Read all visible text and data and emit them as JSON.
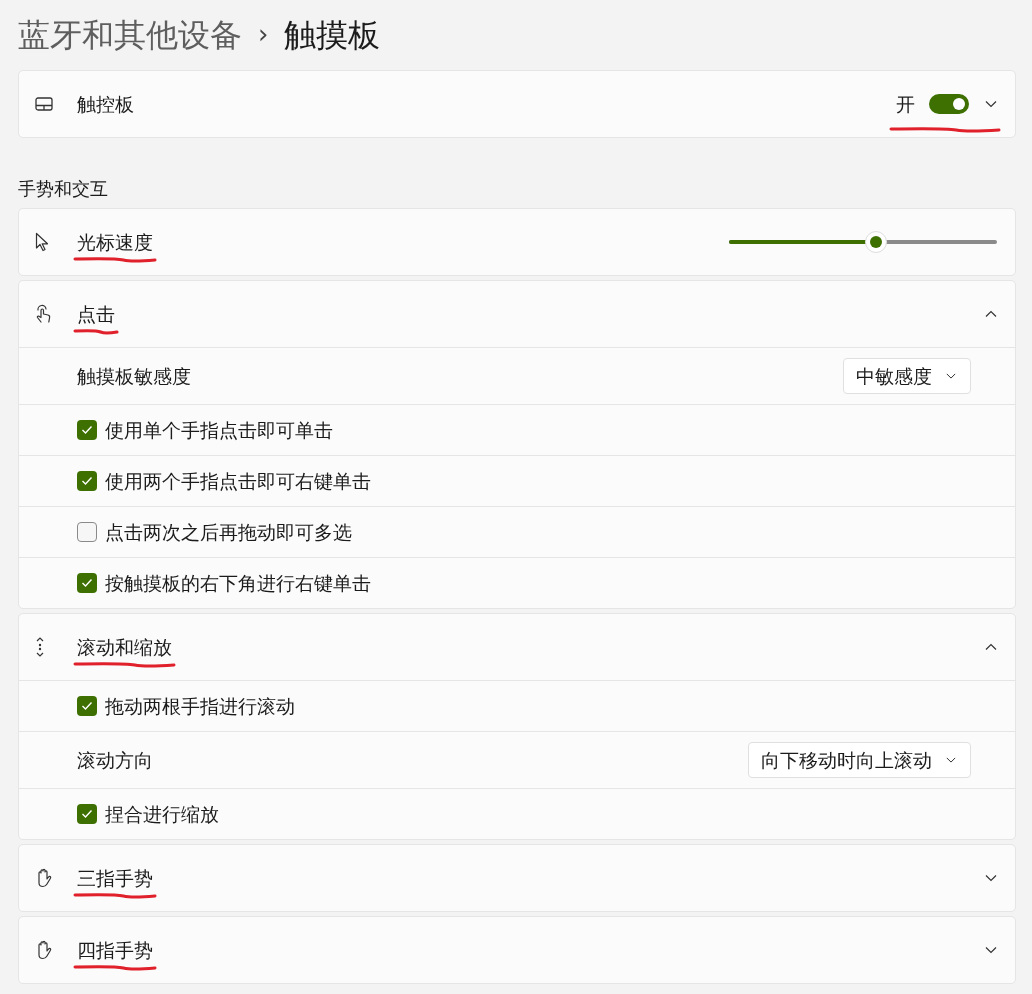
{
  "breadcrumb": {
    "parent": "蓝牙和其他设备",
    "separator": "›",
    "current": "触摸板"
  },
  "touchpad": {
    "label": "触控板",
    "state_text": "开",
    "on": true,
    "expanded": false,
    "underlined": true
  },
  "section_title": "手势和交互",
  "groups": [
    {
      "kind": "slider",
      "label": "光标速度",
      "level": 0.55,
      "underlined": true
    },
    {
      "kind": "expander",
      "label": "点击",
      "expanded": true,
      "underlined": true,
      "rows": [
        {
          "kind": "dropdown",
          "label": "触摸板敏感度",
          "value": "中敏感度"
        },
        {
          "kind": "checkbox",
          "label": "使用单个手指点击即可单击",
          "checked": true
        },
        {
          "kind": "checkbox",
          "label": "使用两个手指点击即可右键单击",
          "checked": true
        },
        {
          "kind": "checkbox",
          "label": "点击两次之后再拖动即可多选",
          "checked": false
        },
        {
          "kind": "checkbox",
          "label": "按触摸板的右下角进行右键单击",
          "checked": true
        }
      ]
    },
    {
      "kind": "expander",
      "label": "滚动和缩放",
      "expanded": true,
      "underlined": true,
      "rows": [
        {
          "kind": "checkbox",
          "label": "拖动两根手指进行滚动",
          "checked": true
        },
        {
          "kind": "dropdown",
          "label": "滚动方向",
          "value": "向下移动时向上滚动"
        },
        {
          "kind": "checkbox",
          "label": "捏合进行缩放",
          "checked": true
        }
      ]
    },
    {
      "kind": "expander",
      "label": "三指手势",
      "expanded": false,
      "underlined": true
    },
    {
      "kind": "expander",
      "label": "四指手势",
      "expanded": false,
      "underlined": true
    }
  ]
}
